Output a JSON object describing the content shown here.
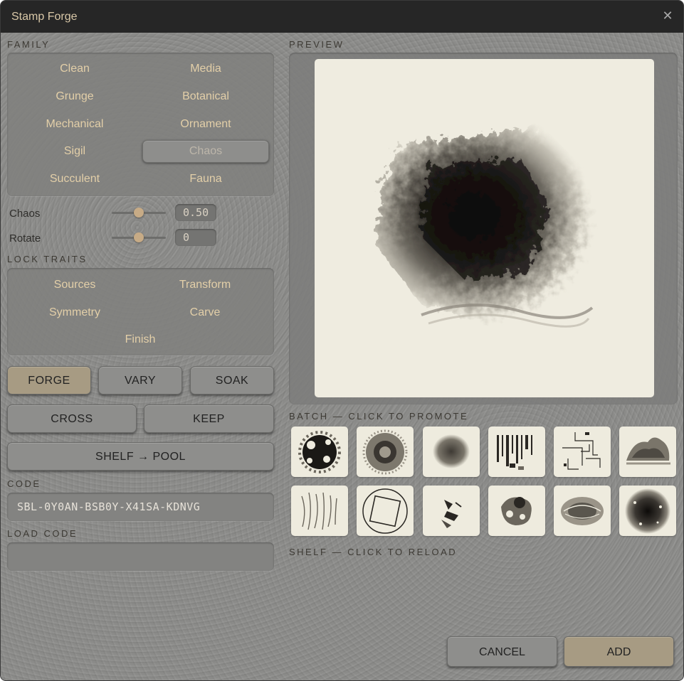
{
  "window": {
    "title": "Stamp Forge"
  },
  "family": {
    "label": "FAMILY",
    "items": [
      {
        "label": "Clean"
      },
      {
        "label": "Media"
      },
      {
        "label": "Grunge"
      },
      {
        "label": "Botanical"
      },
      {
        "label": "Mechanical"
      },
      {
        "label": "Ornament"
      },
      {
        "label": "Sigil"
      },
      {
        "label": "Chaos"
      },
      {
        "label": "Succulent"
      },
      {
        "label": "Fauna"
      }
    ],
    "selected": "Chaos"
  },
  "params": {
    "chaos": {
      "label": "Chaos",
      "value": "0.50",
      "slider_fraction": 0.5
    },
    "rotate": {
      "label": "Rotate",
      "value": "0",
      "slider_fraction": 0.5
    }
  },
  "lock_traits": {
    "label": "LOCK TRAITS",
    "items": [
      {
        "label": "Sources"
      },
      {
        "label": "Transform"
      },
      {
        "label": "Symmetry"
      },
      {
        "label": "Carve"
      },
      {
        "label": "Finish"
      }
    ]
  },
  "actions": {
    "forge": "FORGE",
    "vary": "VARY",
    "soak": "SOAK",
    "cross": "CROSS",
    "keep": "KEEP",
    "shelf_pool": "SHELF → POOL"
  },
  "code": {
    "label": "CODE",
    "value": "SBL-0Y0AN-BSB0Y-X41SA-KDNVG"
  },
  "load_code": {
    "label": "LOAD CODE",
    "value": ""
  },
  "preview": {
    "label": "PREVIEW"
  },
  "batch": {
    "label": "BATCH — CLICK TO PROMOTE"
  },
  "shelf": {
    "label": "SHELF — CLICK TO RELOAD"
  },
  "footer": {
    "cancel": "CANCEL",
    "add": "ADD"
  },
  "colors": {
    "accent": "#c7ab86",
    "chip_text": "#e3cfa8",
    "canvas": "#efece0",
    "titlebar": "#262626"
  },
  "icons": {
    "close": "close-icon"
  }
}
